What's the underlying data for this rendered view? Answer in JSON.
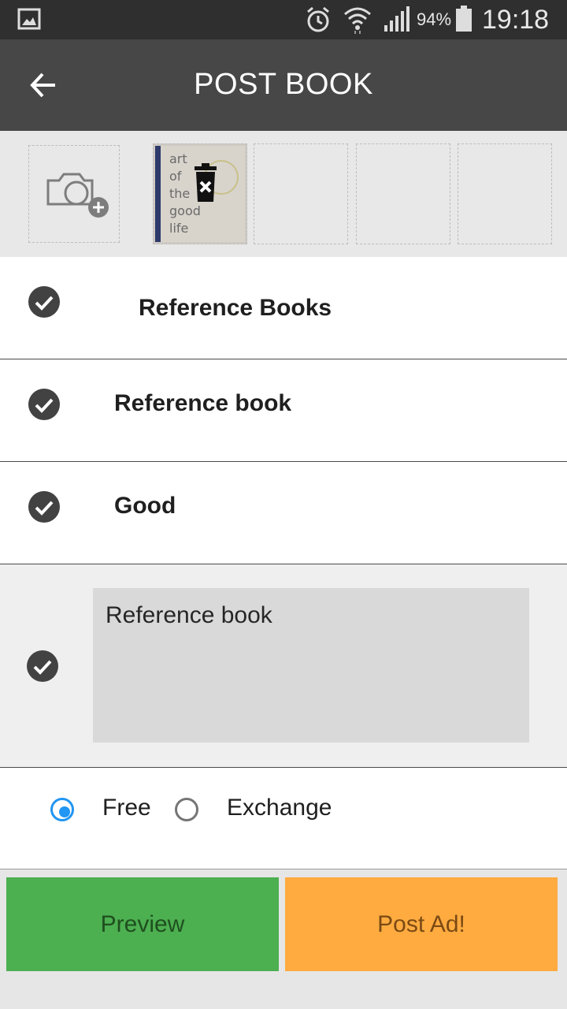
{
  "status_bar": {
    "battery_percent": "94%",
    "time": "19:18",
    "icons": [
      "gallery-icon",
      "alarm-icon",
      "wifi-icon",
      "signal-icon",
      "battery-icon"
    ]
  },
  "app_bar": {
    "title": "POST BOOK",
    "back_icon": "arrow-back-icon"
  },
  "photos": {
    "add_icon": "camera-add-icon",
    "thumbnail_text": [
      "art",
      "of",
      "the",
      "good",
      "life"
    ],
    "delete_icon": "trash-delete-icon"
  },
  "form": {
    "category": "Reference Books",
    "title": "Reference book",
    "condition": "Good",
    "description": "Reference book"
  },
  "options": {
    "free_label": "Free",
    "exchange_label": "Exchange",
    "selected": "Free"
  },
  "buttons": {
    "preview": "Preview",
    "post": "Post Ad!"
  },
  "colors": {
    "status_bar": "#2f2f2f",
    "app_bar": "#474747",
    "preview": "#4caf50",
    "post": "#ffab40",
    "radio_accent": "#2196f3"
  }
}
